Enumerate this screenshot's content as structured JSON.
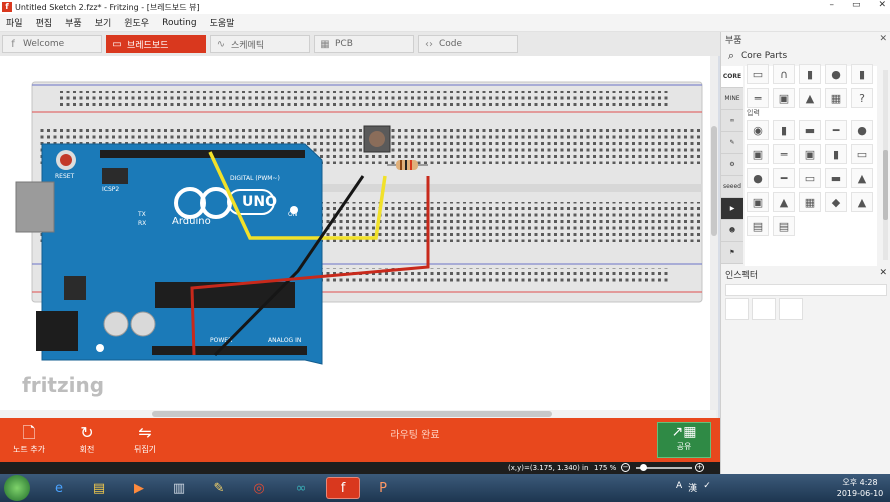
{
  "window": {
    "title": "Untitled Sketch 2.fzz* - Fritzing - [브레드보드 뷰]",
    "app_badge": "f",
    "controls": [
      "–",
      "▭",
      "✕"
    ]
  },
  "menu": [
    "파일",
    "편집",
    "부품",
    "보기",
    "윈도우",
    "Routing",
    "도움말"
  ],
  "tabs": [
    {
      "label": "Welcome",
      "icon": "f"
    },
    {
      "label": "브레드보드",
      "icon": "▭"
    },
    {
      "label": "스케메틱",
      "icon": "∿"
    },
    {
      "label": "PCB",
      "icon": "▦"
    },
    {
      "label": "Code",
      "icon": "‹›"
    }
  ],
  "active_tab": "브레드보드",
  "canvas": {
    "arduino_reset_label": "RESET",
    "arduino_brand": "Arduino",
    "arduino_model": "UNO",
    "arduino_icsp": "ICSP2",
    "arduino_digital": "DIGITAL (PWM~)",
    "arduino_on": "ON",
    "arduino_tx": "TX",
    "arduino_rx": "RX",
    "arduino_power": "POWER",
    "arduino_analog": "ANALOG IN",
    "watermark": "fritzing"
  },
  "toolbar": {
    "add_note": "노트 추가",
    "rotate": "회전",
    "flip": "뒤집기",
    "routing_status": "라우팅 완료",
    "share": "공유"
  },
  "status": {
    "coords": "(x,y)=(3.175, 1.340) in",
    "zoom": "175 %",
    "zoom_out": "−",
    "zoom_in": "+"
  },
  "parts_bin": {
    "header": "부품",
    "close": "✕",
    "title": "Core Parts",
    "bin_tabs": [
      "CORE",
      "MINE",
      "∞",
      "✎",
      "⚙",
      "seeed",
      "▶",
      "☻",
      "⚑",
      "▤"
    ],
    "category_input": "입력",
    "rows1": [
      [
        "▭",
        "∩",
        "▮",
        "●",
        "▮"
      ],
      [
        "═",
        "▣",
        "▲",
        "▦",
        "?"
      ]
    ],
    "rows2": [
      [
        "◉",
        "▮",
        "▬",
        "━",
        "●"
      ],
      [
        "▣",
        "═",
        "▣",
        "▮",
        "▭"
      ],
      [
        "●",
        "━",
        "▭",
        "▬",
        "▲"
      ],
      [
        "▣",
        "▲",
        "▦",
        "◆",
        "▲"
      ],
      [
        "▤",
        "▤",
        "",
        "",
        ""
      ]
    ]
  },
  "inspector": {
    "header": "인스펙터",
    "close": "✕"
  },
  "taskbar": {
    "icons": [
      "e",
      "▤",
      "▶",
      "▥",
      "✎",
      "◎",
      "∞",
      "f",
      "P"
    ],
    "active_index": 7,
    "tray": [
      "A",
      "漢",
      "✓"
    ],
    "clock_time": "오후 4:28",
    "clock_date": "2019-06-10"
  },
  "colors": {
    "accent": "#e8481d",
    "arduino": "#1b7ab8",
    "share": "#2f8a45"
  }
}
